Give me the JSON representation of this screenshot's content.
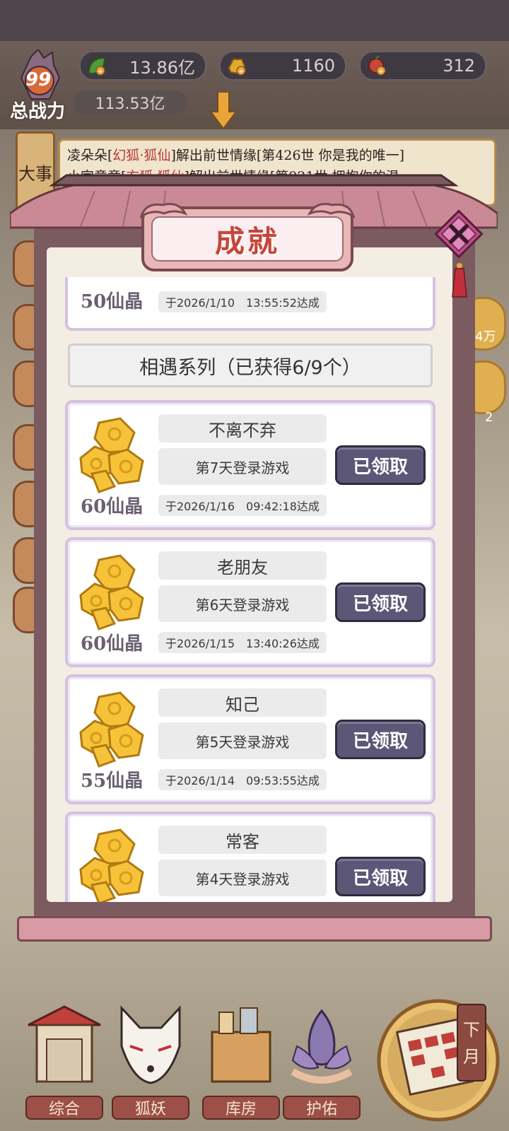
{
  "hud": {
    "resources": [
      {
        "value": "13.86亿",
        "icon": "green-leaf-icon",
        "color": "#4f9a3a"
      },
      {
        "value": "1160",
        "icon": "gold-gem-icon",
        "color": "#e3a92e"
      },
      {
        "value": "312",
        "icon": "red-fruit-icon",
        "color": "#c9463a"
      }
    ],
    "power_level": "99",
    "power_label": "总战力",
    "power_value": "113.53亿"
  },
  "news": {
    "side_label": "大事",
    "line1_prefix": "凌朵朵[",
    "line1_red": "幻狐·狐仙",
    "line1_suffix": "]解出前世情缘[第426世 你是我的唯一]",
    "line2_prefix": "小宫意童[",
    "line2_red": "玄狐·狐仙",
    "line2_suffix": "]解出前世情缘[第921世 拥抱你的温"
  },
  "modal": {
    "title": "成就",
    "partial": {
      "reward": "50仙晶",
      "date": "于2026/1/10　13:55:52达成"
    },
    "series_header": "相遇系列（已获得6/9个）",
    "cards": [
      {
        "name": "不离不弃",
        "desc": "第7天登录游戏",
        "reward": "60仙晶",
        "date": "于2026/1/16　09:42:18达成",
        "button": "已领取"
      },
      {
        "name": "老朋友",
        "desc": "第6天登录游戏",
        "reward": "60仙晶",
        "date": "于2026/1/15　13:40:26达成",
        "button": "已领取"
      },
      {
        "name": "知己",
        "desc": "第5天登录游戏",
        "reward": "55仙晶",
        "date": "于2026/1/14　09:53:55达成",
        "button": "已领取"
      },
      {
        "name": "常客",
        "desc": "第4天登录游戏",
        "reward": "",
        "date": "",
        "button": "已领取"
      }
    ]
  },
  "nav": {
    "items": [
      "综合",
      "狐妖",
      "库房",
      "护佑"
    ],
    "next_month": "下月"
  },
  "side_text": {
    "right1": "4万",
    "right2": "2"
  }
}
